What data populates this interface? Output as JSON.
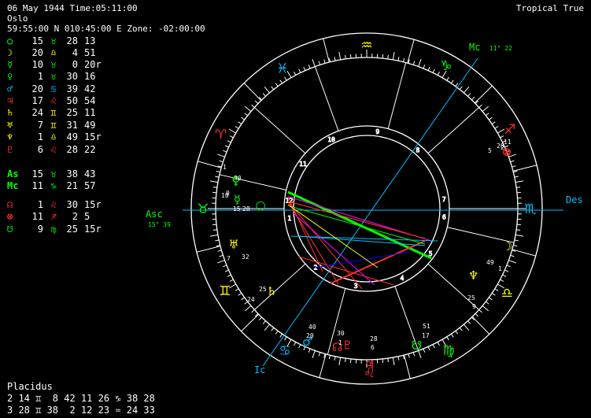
{
  "header": {
    "line1": "06 May 1944 Time:05:11:00",
    "line2": "Oslo",
    "line3": "59:55:00 N 010:45:00 E Zone: -02:00:00",
    "mode": "Tropical True"
  },
  "positions": [
    {
      "glyph": "○",
      "gc": "#00ff00",
      "d1": "15",
      "sg": "♉",
      "sc": "#00ff00",
      "d2": "28",
      "d3": "13"
    },
    {
      "glyph": "☽",
      "gc": "#ffff00",
      "d1": "20",
      "sg": "♎",
      "sc": "#ffff00",
      "d2": "4",
      "d3": "51"
    },
    {
      "glyph": "☿",
      "gc": "#00ff00",
      "d1": "10",
      "sg": "♉",
      "sc": "#00ff00",
      "d2": "0",
      "d3": "20r"
    },
    {
      "glyph": "♀",
      "gc": "#00ff00",
      "d1": "1",
      "sg": "♉",
      "sc": "#00ff00",
      "d2": "30",
      "d3": "16"
    },
    {
      "glyph": "♂",
      "gc": "#00bfff",
      "d1": "20",
      "sg": "♋",
      "sc": "#00bfff",
      "d2": "39",
      "d3": "42"
    },
    {
      "glyph": "♃",
      "gc": "#ff3030",
      "d1": "17",
      "sg": "♌",
      "sc": "#ff3030",
      "d2": "50",
      "d3": "54"
    },
    {
      "glyph": "♄",
      "gc": "#ffff00",
      "d1": "24",
      "sg": "♊",
      "sc": "#ffff00",
      "d2": "25",
      "d3": "11"
    },
    {
      "glyph": "♅",
      "gc": "#ffff00",
      "d1": "7",
      "sg": "♊",
      "sc": "#ffff00",
      "d2": "31",
      "d3": "49"
    },
    {
      "glyph": "♆",
      "gc": "#ffff00",
      "d1": "1",
      "sg": "♎",
      "sc": "#ffff00",
      "d2": "49",
      "d3": "15r"
    },
    {
      "glyph": "♇",
      "gc": "#ff3030",
      "d1": "6",
      "sg": "♌",
      "sc": "#ff3030",
      "d2": "28",
      "d3": "22"
    },
    {
      "glyph": "As",
      "gc": "#00ff00",
      "d1": "15",
      "sg": "♉",
      "sc": "#00ff00",
      "d2": "38",
      "d3": "43"
    },
    {
      "glyph": "Mc",
      "gc": "#00ff00",
      "d1": "11",
      "sg": "♑",
      "sc": "#00ff00",
      "d2": "21",
      "d3": "57"
    },
    {
      "glyph": "☊",
      "gc": "#ff3030",
      "d1": "1",
      "sg": "♌",
      "sc": "#ff3030",
      "d2": "30",
      "d3": "15r"
    },
    {
      "glyph": "⊗",
      "gc": "#ff3030",
      "d1": "11",
      "sg": "♐",
      "sc": "#ff3030",
      "d2": "2",
      "d3": "5"
    },
    {
      "glyph": "☋",
      "gc": "#00ff00",
      "d1": "9",
      "sg": "♍",
      "sc": "#00ff00",
      "d2": "25",
      "d3": "15r"
    }
  ],
  "houses": {
    "system": "Placidus",
    "row1": "2 14 ♊  8 42 11 26 ♑ 38 28",
    "row2": "3 28 ♊ 38  2 12 23 ♒ 24 33"
  },
  "wheel": {
    "asc_label": "Asc",
    "asc_deg": "15° 39",
    "mc_label": "Mc",
    "mc_deg": "11° 22",
    "ic_label": "Ic",
    "des_label": "Des",
    "house_numbers": [
      "1",
      "2",
      "3",
      "4",
      "5",
      "6",
      "7",
      "8",
      "9",
      "10",
      "11",
      "12"
    ],
    "planet_labels": [
      {
        "t": "30",
        "c": "#fff"
      },
      {
        "t": "1",
        "c": "#fff"
      },
      {
        "t": "10",
        "c": "#fff"
      },
      {
        "t": "0",
        "c": "#fff"
      },
      {
        "t": "15",
        "c": "#fff"
      },
      {
        "t": "28",
        "c": "#fff"
      },
      {
        "t": "7",
        "c": "#fff"
      },
      {
        "t": "32",
        "c": "#fff"
      },
      {
        "t": "24",
        "c": "#fff"
      },
      {
        "t": "25",
        "c": "#fff"
      },
      {
        "t": "40",
        "c": "#fff"
      },
      {
        "t": "20",
        "c": "#fff"
      },
      {
        "t": "30",
        "c": "#fff"
      },
      {
        "t": "1",
        "c": "#fff"
      },
      {
        "t": "28",
        "c": "#fff"
      },
      {
        "t": "6",
        "c": "#fff"
      },
      {
        "t": "51",
        "c": "#fff"
      },
      {
        "t": "17",
        "c": "#fff"
      },
      {
        "t": "25",
        "c": "#fff"
      },
      {
        "t": "9",
        "c": "#fff"
      },
      {
        "t": "49",
        "c": "#fff"
      },
      {
        "t": "1",
        "c": "#fff"
      },
      {
        "t": "5",
        "c": "#fff"
      },
      {
        "t": "20",
        "c": "#fff"
      },
      {
        "t": "2",
        "c": "#fff"
      },
      {
        "t": "11",
        "c": "#fff"
      }
    ]
  }
}
